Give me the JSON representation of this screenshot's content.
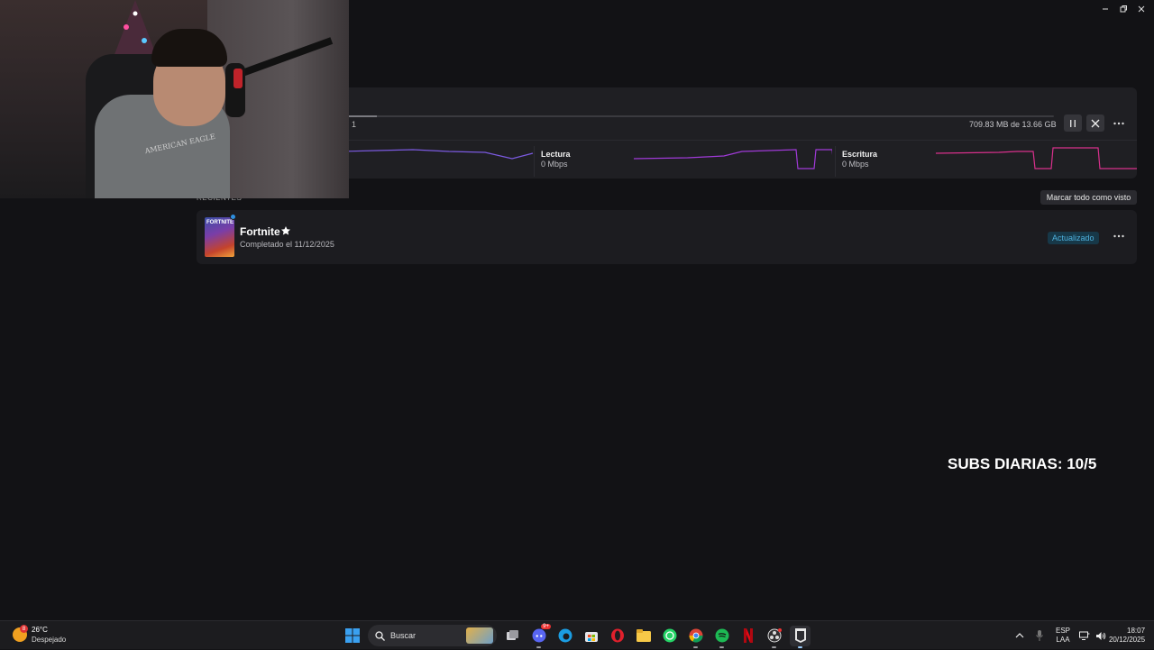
{
  "download": {
    "queue_index": "1",
    "progress_fraction": 0.05,
    "size_text": "709.83 MB de 13.66 GB",
    "read_label": "Lectura",
    "read_value": "0 Mbps",
    "write_label": "Escritura",
    "write_value": "0 Mbps",
    "graph_colors": {
      "network": "#7b5ae0",
      "read": "#a03ad8",
      "write": "#d8308c"
    }
  },
  "recents": {
    "section_label": "RECIENTES",
    "mark_all_seen": "Marcar todo como visto",
    "items": [
      {
        "title": "Fortnite",
        "subtitle": "Completado el 11/12/2025",
        "badge": "Actualizado",
        "thumb_text": "FORTNITE"
      }
    ]
  },
  "webcam": {
    "shirt_text": "AMERICAN EAGLE"
  },
  "overlay": {
    "subs_text": "SUBS DIARIAS: 10/5"
  },
  "taskbar": {
    "weather_badge": "8",
    "weather_temp": "26°C",
    "weather_desc": "Despejado",
    "search_label": "Buscar",
    "discord_badge": "9+",
    "lang_line1": "ESP",
    "lang_line2": "LAA",
    "time": "18:07",
    "date": "20/12/2025",
    "icons": [
      "windows-start-icon",
      "task-view-icon",
      "discord-icon",
      "edge-icon",
      "store-icon",
      "opera-icon",
      "file-explorer-icon",
      "whatsapp-icon",
      "chrome-icon",
      "spotify-icon",
      "netflix-icon",
      "obs-icon",
      "epic-games-icon"
    ]
  },
  "colors": {
    "background": "#121215",
    "panel": "#1f1f23",
    "badge_text": "#4eb0dc",
    "badge_bg": "#173848"
  }
}
